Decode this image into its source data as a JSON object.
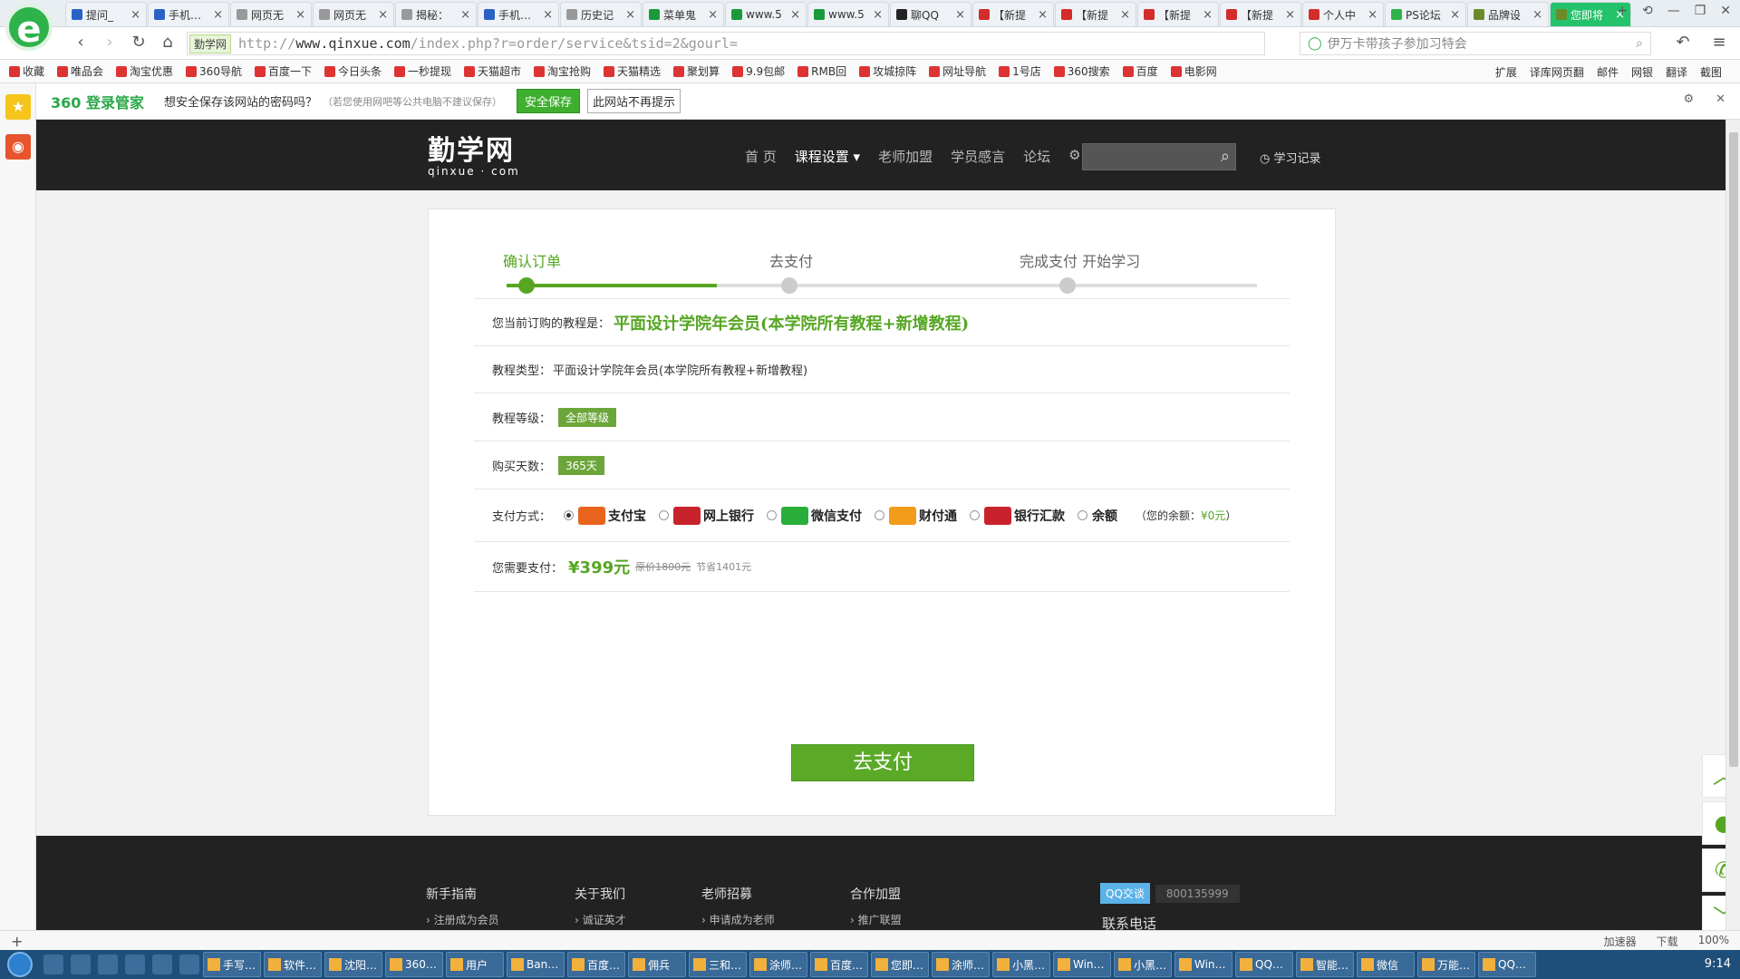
{
  "browser": {
    "tabs": [
      {
        "title": "提问_",
        "active": false,
        "color": "#2a62c4"
      },
      {
        "title": "手机…",
        "active": false,
        "color": "#2a62c4"
      },
      {
        "title": "网页无",
        "active": false,
        "color": "#999999"
      },
      {
        "title": "网页无",
        "active": false,
        "color": "#999999"
      },
      {
        "title": "揭秘：",
        "active": false,
        "color": "#999999"
      },
      {
        "title": "手机…",
        "active": false,
        "color": "#2a62c4"
      },
      {
        "title": "历史记",
        "active": false,
        "color": "#999999"
      },
      {
        "title": "菜单鬼",
        "active": false,
        "color": "#1a9a3a"
      },
      {
        "title": "www.5",
        "active": false,
        "color": "#1a9a3a"
      },
      {
        "title": "www.5",
        "active": false,
        "color": "#1a9a3a"
      },
      {
        "title": "聊QQ",
        "active": false,
        "color": "#222222"
      },
      {
        "title": "【新提",
        "active": false,
        "color": "#d42b2b"
      },
      {
        "title": "【新提",
        "active": false,
        "color": "#d42b2b"
      },
      {
        "title": "【新提",
        "active": false,
        "color": "#d42b2b"
      },
      {
        "title": "【新提",
        "active": false,
        "color": "#d42b2b"
      },
      {
        "title": "个人中",
        "active": false,
        "color": "#d42b2b"
      },
      {
        "title": "PS论坛",
        "active": false,
        "color": "#2eb34a"
      },
      {
        "title": "品牌设",
        "active": false,
        "color": "#6b8a2a"
      },
      {
        "title": "您即将",
        "active": true,
        "color": "#6b8a2a"
      }
    ],
    "site_badge": "勤学网",
    "url_host": "www.qinxue.com",
    "url_prefix": "http://",
    "url_path": "/index.php?r=order/service&tsid=2&gourl=",
    "search_placeholder": "伊万卡带孩子参加习特会"
  },
  "bookmarks": [
    "收藏",
    "唯品会",
    "淘宝优惠",
    "360导航",
    "百度一下",
    "今日头条",
    "一秒提现",
    "天猫超市",
    "淘宝抢购",
    "天猫精选",
    "聚划算",
    "9.9包邮",
    "RMB回",
    "攻城掠阵",
    "网址导航",
    "1号店",
    "360搜索",
    "百度",
    "电影网"
  ],
  "bookmarks_right": [
    "扩展",
    "译库网页翻",
    "邮件",
    "网银",
    "翻译",
    "截图"
  ],
  "notice": {
    "brand": "360 登录管家",
    "text": "想安全保存该网站的密码吗？",
    "hint": "（若您使用网吧等公共电脑不建议保存）",
    "save": "安全保存",
    "never": "此网站不再提示"
  },
  "site": {
    "logo_cn": "勤学网",
    "logo_en": "qinxue · com",
    "nav": [
      "首 页",
      "课程设置 ▾",
      "老师加盟",
      "学员感言",
      "论坛"
    ],
    "history": "学习记录"
  },
  "order": {
    "steps": [
      "确认订单",
      "去支付",
      "完成支付 开始学习"
    ],
    "course_label": "您当前订购的教程是：",
    "course_name": "平面设计学院年会员(本学院所有教程+新增教程)",
    "type_label": "教程类型：",
    "type_value": "平面设计学院年会员(本学院所有教程+新增教程)",
    "level_label": "教程等级：",
    "level_value": "全部等级",
    "days_label": "购买天数：",
    "days_value": "365天",
    "pay_label": "支付方式：",
    "pay_methods": [
      {
        "name": "支付宝",
        "selected": true,
        "color": "#e8641c",
        "icon": "alipay-icon"
      },
      {
        "name": "网上银行",
        "selected": false,
        "color": "#c8232c",
        "icon": "unionpay-icon"
      },
      {
        "name": "微信支付",
        "selected": false,
        "color": "#2aae3a",
        "icon": "wechat-icon"
      },
      {
        "name": "财付通",
        "selected": false,
        "color": "#f39b1a",
        "icon": "tenpay-icon"
      },
      {
        "name": "银行汇款",
        "selected": false,
        "color": "#c8232c",
        "icon": "unionpay-icon"
      },
      {
        "name": "余额",
        "selected": false,
        "color": "#ffffff",
        "icon": "balance-icon"
      }
    ],
    "balance_label": "（您的余额：",
    "balance_value": "¥0元",
    "balance_end": "）",
    "amount_label": "您需要支付：",
    "amount": "¥399元",
    "original": "原价1800元",
    "saved": "节省1401元",
    "pay_button": "去支付"
  },
  "footer": {
    "cols": [
      {
        "title": "新手指南",
        "sub": "注册成为会员"
      },
      {
        "title": "关于我们",
        "sub": "诚证英才"
      },
      {
        "title": "老师招募",
        "sub": "申请成为老师"
      },
      {
        "title": "合作加盟",
        "sub": "推广联盟"
      }
    ],
    "qq_label": "QQ交谈",
    "qq_number": "800135999",
    "contact": "联系电话"
  },
  "statusbar": {
    "accelerate": "加速器",
    "download": "下载",
    "zoom": "100%"
  },
  "taskbar": {
    "items": [
      "手写…",
      "软件…",
      "沈阳…",
      "360…",
      "用户",
      "Ban…",
      "百度…",
      "佣兵",
      "三和…",
      "涂师…",
      "百度…",
      "您即…",
      "涂师…",
      "小黑…",
      "Win…",
      "小黑…",
      "Win…",
      "QQ…",
      "智能…",
      "微信",
      "万能…",
      "QQ…"
    ],
    "time": "9:14"
  },
  "colors": {
    "accent": "#56a623",
    "header": "#222222",
    "active_tab": "#24c26a"
  }
}
